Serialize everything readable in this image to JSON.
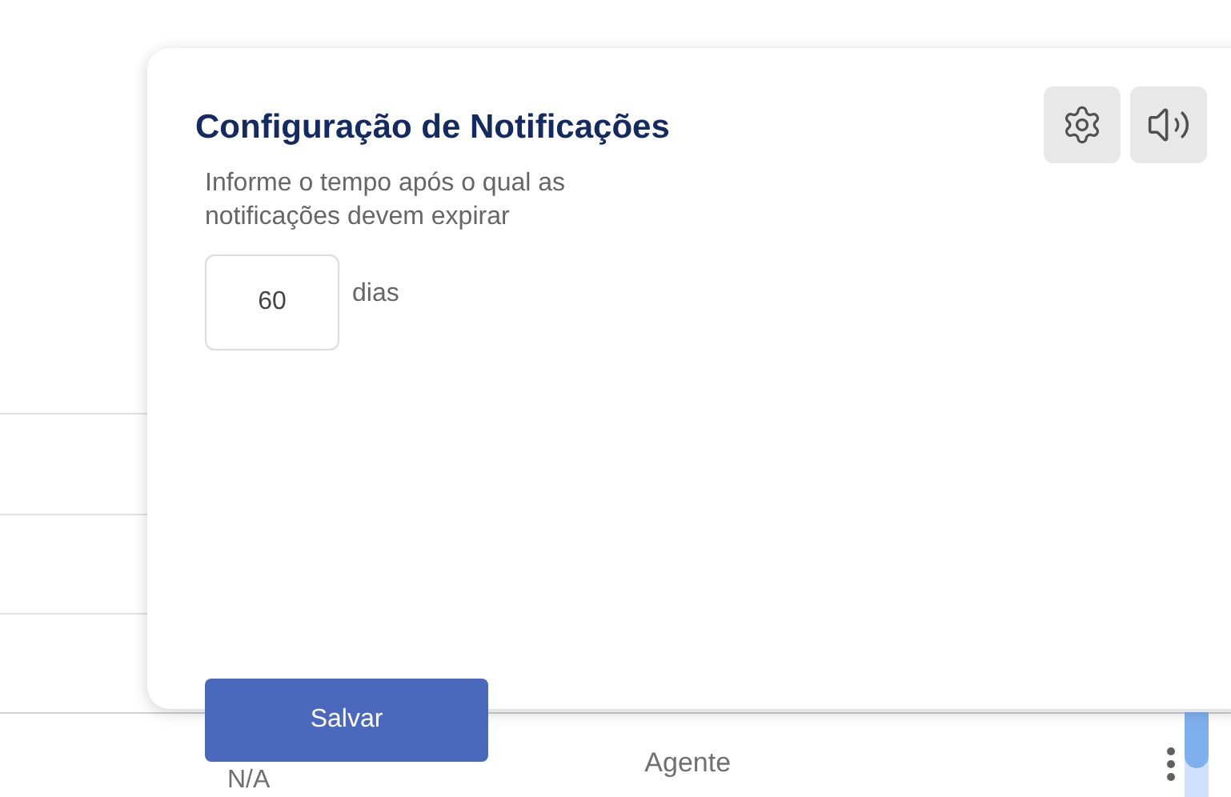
{
  "background_table": {
    "rows": [
      {
        "column_1": "N/A",
        "column_2": "Agente"
      }
    ]
  },
  "dialog": {
    "title": "Configuração de Notificações",
    "description": "Informe o tempo após o qual as notificações devem expirar",
    "expiry": {
      "value": "60",
      "unit": "dias"
    },
    "save_button": "Salvar"
  }
}
